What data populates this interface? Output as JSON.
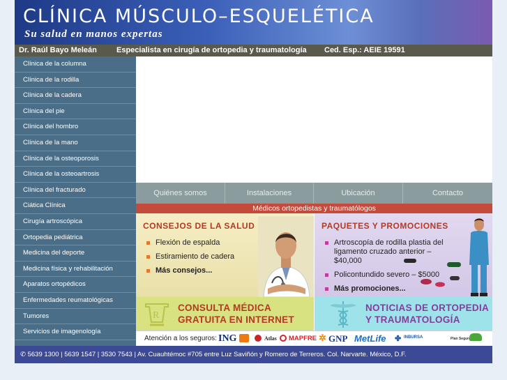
{
  "header": {
    "title": "CLÍNICA MÚSCULO–ESQUELÉTICA",
    "slogan": "Su salud en manos expertas"
  },
  "infobar": {
    "doctor": "Dr. Raúl Bayo Meleán",
    "specialty": "Especialista en cirugía de ortopedia y traumatología",
    "license": "Ced. Esp.: AEIE 19591"
  },
  "sidebar": {
    "items": [
      "Clínica de la columna",
      "Clínica de la rodilla",
      "Clínica de la cadera",
      "Clínica del pie",
      "Clínica del hombro",
      "Clínica de la mano",
      "Clínica de la osteoporosis",
      "Clínica de la osteoartrosis",
      "Clínica del fracturado",
      "Ciática Clínica",
      "Cirugía artroscópica",
      "Ortopedia pediátrica",
      "Medicina del deporte",
      "Medicina física y rehabilitación",
      "Aparatos ortopédicos",
      "Enfermedades reumatológicas",
      "Tumores",
      "Servicios de imagenología"
    ]
  },
  "nav": {
    "items": [
      "Quiénes somos",
      "Instalaciones",
      "Ubicación",
      "Contacto"
    ]
  },
  "subtitle_bar": "Médicos ortopedistas y traumatólogos",
  "consejos": {
    "title": "CONSEJOS DE LA SALUD",
    "items": [
      "Flexión de espalda",
      "Estiramiento de cadera"
    ],
    "more": "Más consejos..."
  },
  "paquetes": {
    "title": "PAQUETES Y PROMOCIONES",
    "items": [
      "Artroscopía de rodilla plastia del ligamento cruzado anterior – $40,000",
      "Policontundido severo – $5000"
    ],
    "more": "Más promociones..."
  },
  "promo_left": {
    "line1": "CONSULTA MÉDICA",
    "line2": "GRATUITA EN INTERNET"
  },
  "promo_right": {
    "line1": "NOTICIAS DE ORTOPEDIA",
    "line2": "Y TRAUMATOLOGÍA"
  },
  "insurance": {
    "label": "Atención a los seguros:",
    "logos": [
      "ING",
      "Atlas",
      "MAPFRE",
      "GNP",
      "MetLife",
      "INBURSA",
      "Plan Seguro"
    ]
  },
  "footer": "✆ 5639 1300 | 5639 1547 | 3530 7543 | Av. Cuauhtémoc #705 entre Luz Saviñón y Romero de Terreros. Col. Narvarte. México, D.F.",
  "colors": {
    "header_blue": "#3b5fb8",
    "sidebar": "#4a6e87",
    "nav": "#8a9c9e",
    "red_bar": "#c44a3c",
    "title_red": "#b33a24",
    "promo_green": "#d8e280",
    "promo_cyan": "#9ee3ea",
    "footer": "#3c4a95"
  }
}
